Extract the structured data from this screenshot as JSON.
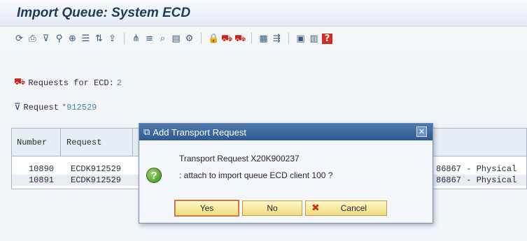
{
  "window": {
    "title": "Import Queue: System ECD"
  },
  "toolbar": {
    "groups": [
      [
        "refresh-icon",
        "print-icon",
        "filter-icon",
        "find-icon",
        "zoom-icon",
        "details-icon",
        "sort-icon",
        "upload-icon"
      ],
      [
        "tree-icon",
        "list-icon",
        "search-icon",
        "document-icon",
        "settings-icon"
      ],
      [
        "lock-icon",
        "truck-import-icon",
        "truck-export-icon"
      ],
      [
        "table-icon",
        "transport-icon"
      ],
      [
        "layout-icon",
        "grid-icon",
        "help-icon"
      ]
    ],
    "glyphs": {
      "refresh-icon": "⟳",
      "print-icon": "⎙",
      "filter-icon": "⊽",
      "find-icon": "⚲",
      "zoom-icon": "⊕",
      "details-icon": "☰",
      "sort-icon": "⇅",
      "upload-icon": "⇪",
      "tree-icon": "⋔",
      "list-icon": "≡",
      "search-icon": "⌕",
      "document-icon": "▤",
      "settings-icon": "⚙",
      "lock-icon": "🔒",
      "truck-import-icon": "⛟",
      "truck-export-icon": "⛟",
      "table-icon": "▦",
      "transport-icon": "⇶",
      "layout-icon": "▣",
      "grid-icon": "▥",
      "help-icon": "?"
    }
  },
  "info": {
    "requests_label": "Requests for ECD:",
    "requests_count": "2",
    "filter_label": "Request",
    "filter_value": "*912529"
  },
  "table": {
    "columns": [
      "Number",
      "Request"
    ],
    "rows": [
      {
        "number": "10890",
        "request": "ECDK912529",
        "desc": "86867 - Physical"
      },
      {
        "number": "10891",
        "request": "ECDK912529",
        "desc": "86867 - Physical"
      }
    ]
  },
  "dialog": {
    "title": "Add Transport Request",
    "line1": "Transport Request X20K900237",
    "line2": ": attach to import queue ECD client 100 ?",
    "buttons": {
      "yes": "Yes",
      "no": "No",
      "cancel": "Cancel"
    }
  },
  "colors": {
    "title_bar": "#2e5a92",
    "button_face": "#f1dd7c",
    "question_icon": "#3a8b1c",
    "cancel_x": "#d42b25"
  }
}
